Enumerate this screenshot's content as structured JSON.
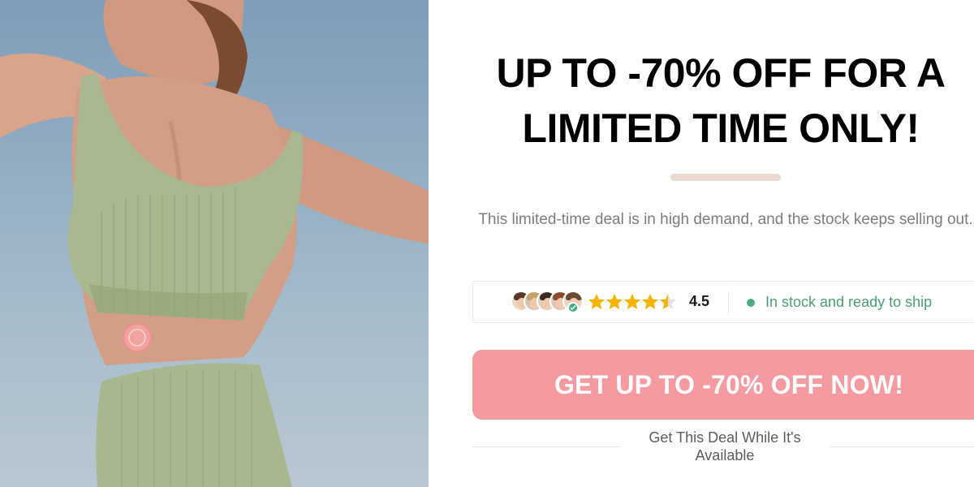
{
  "hero": {
    "image_alt": "woman-in-green-activewear",
    "patch_icon": "patch-sticker-icon"
  },
  "offer": {
    "headline_line1": "UP TO -70% OFF FOR A",
    "headline_line2": "LIMITED TIME ONLY!",
    "description": "This limited-time deal is in high demand, and the stock keeps selling out."
  },
  "trust": {
    "rating": "4.5",
    "rating_stars": 4.5,
    "stock_status": "In stock and ready to ship"
  },
  "cta": {
    "label": "GET UP TO -70% OFF NOW!",
    "note": "Get This Deal While It's Available"
  },
  "colors": {
    "cta_background": "#f59aa0",
    "divider": "#ecd9cf",
    "star": "#f5b400",
    "stock_green": "#4a9e6f"
  }
}
